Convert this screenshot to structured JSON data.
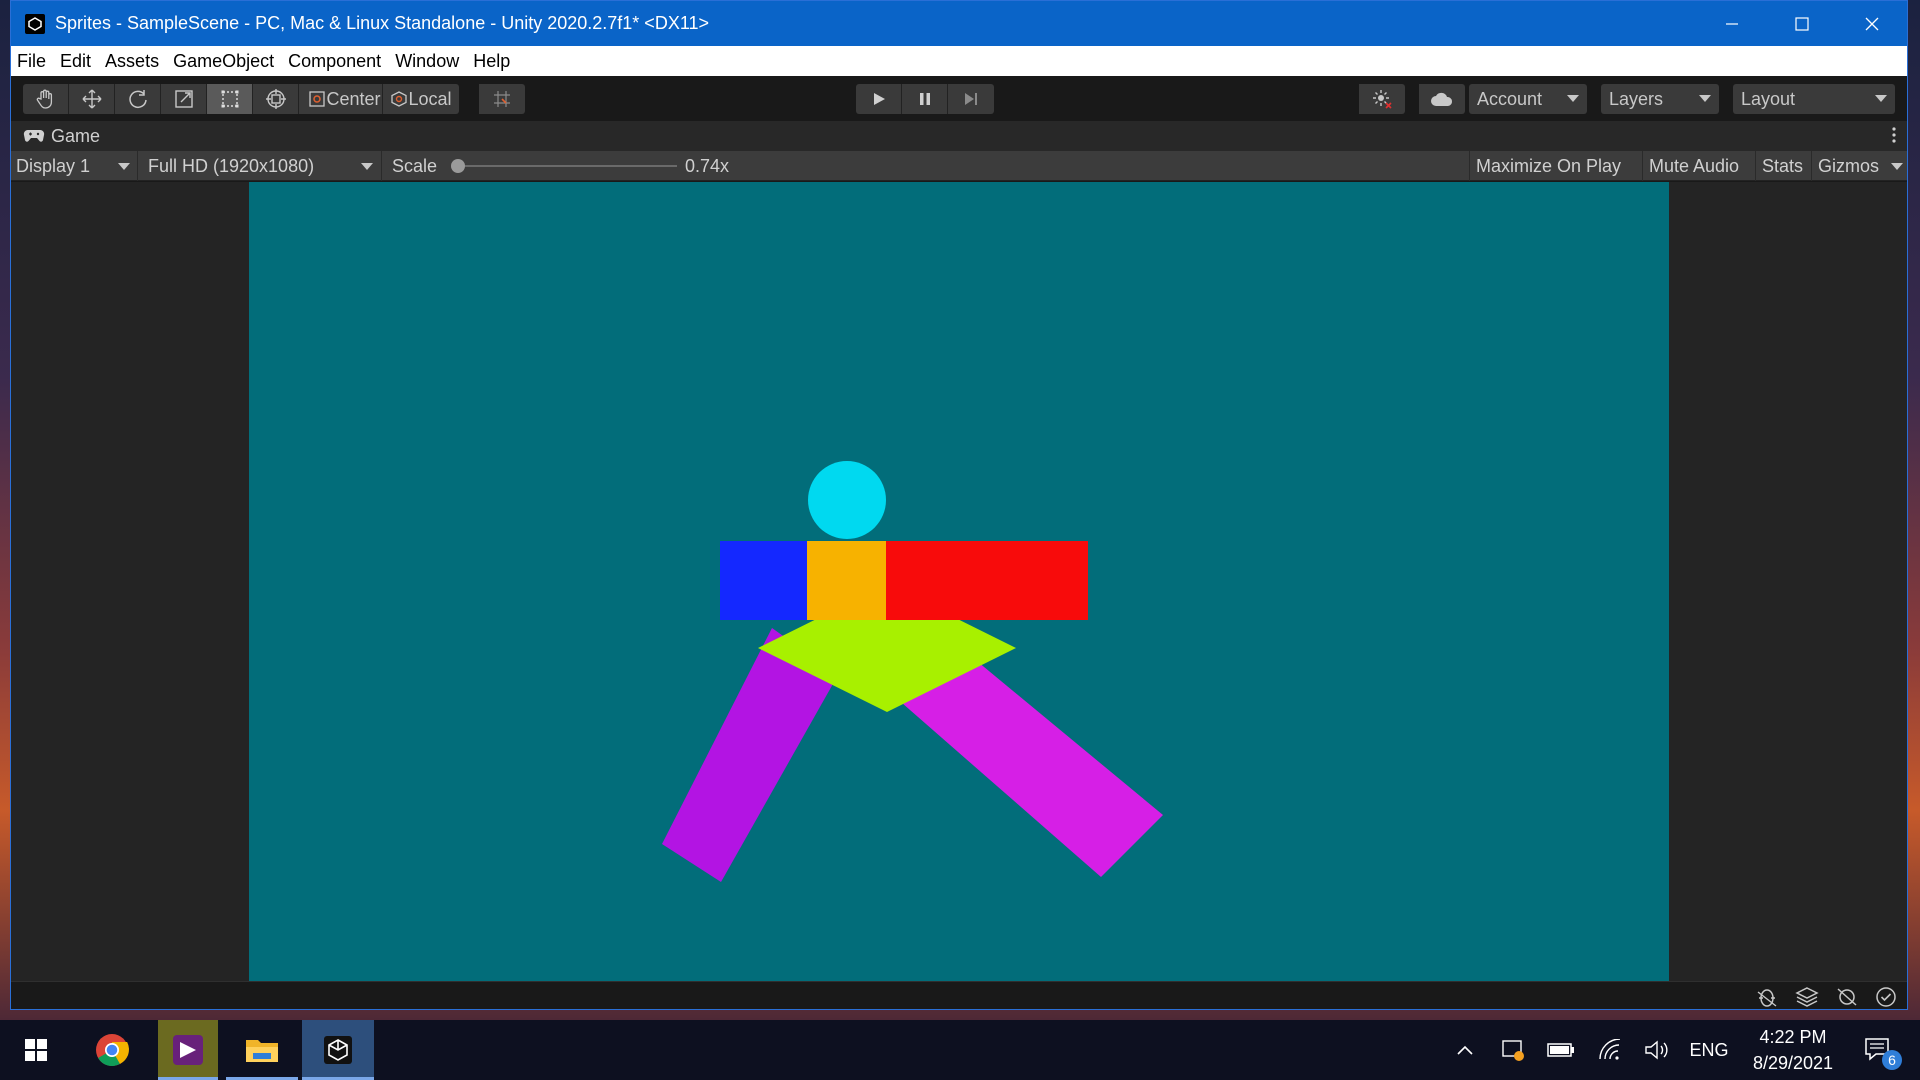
{
  "window": {
    "title": "Sprites - SampleScene - PC, Mac & Linux Standalone - Unity 2020.2.7f1* <DX11>"
  },
  "menu": [
    "File",
    "Edit",
    "Assets",
    "GameObject",
    "Component",
    "Window",
    "Help"
  ],
  "toolbar": {
    "pivot_label": "Center",
    "space_label": "Local",
    "account_label": "Account",
    "layers_label": "Layers",
    "layout_label": "Layout"
  },
  "game_tab": {
    "label": "Game"
  },
  "game_bar": {
    "display": "Display 1",
    "resolution": "Full HD (1920x1080)",
    "scale_label": "Scale",
    "scale_value": "0.74x",
    "maximize_on_play": "Maximize On Play",
    "mute_audio": "Mute Audio",
    "stats": "Stats",
    "gizmos": "Gizmos"
  },
  "scene": {
    "background_color": "#026d7a",
    "sprites": [
      {
        "name": "head",
        "color": "#00d9f0"
      },
      {
        "name": "left-arm",
        "color": "#1428ff"
      },
      {
        "name": "torso",
        "color": "#f7b200"
      },
      {
        "name": "right-arm",
        "color": "#f80b0b"
      },
      {
        "name": "hips",
        "color": "#a8f000"
      },
      {
        "name": "left-leg",
        "color": "#b314e3"
      },
      {
        "name": "right-leg",
        "color": "#d61fe6"
      }
    ]
  },
  "taskbar": {
    "language": "ENG",
    "time": "4:22 PM",
    "date": "8/29/2021",
    "notification_count": "6"
  }
}
